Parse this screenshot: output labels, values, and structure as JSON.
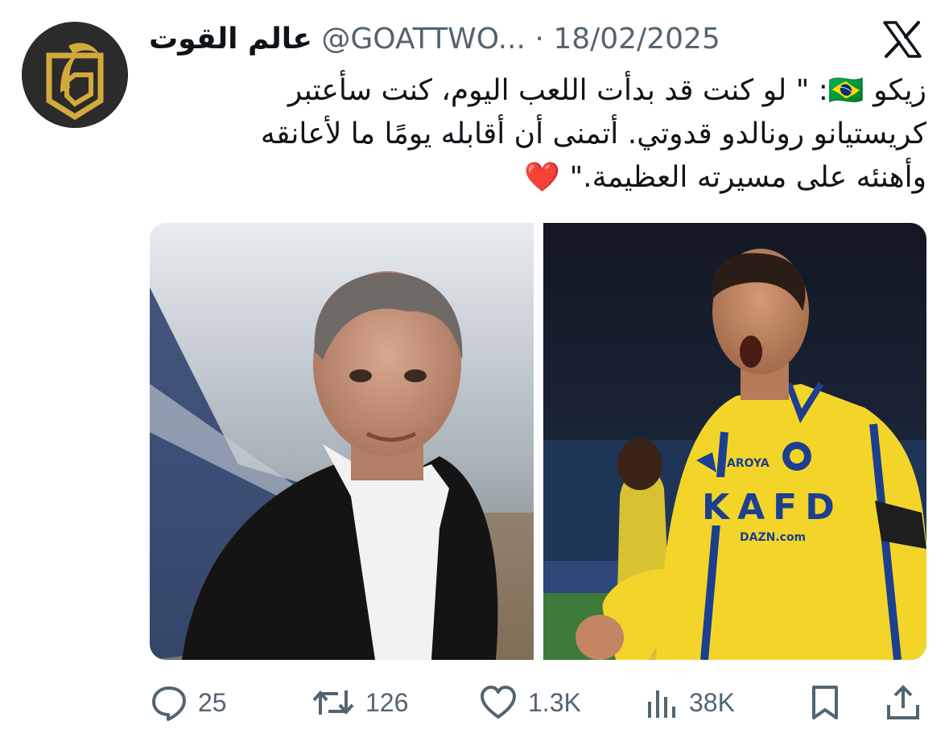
{
  "author": {
    "name": "عالم القوت",
    "handle": "@GOATTWO...",
    "separator": "·",
    "date": "18/02/2025"
  },
  "tweet": {
    "lines": [
      "زيكو 🇧🇷: \" لو كنت قد بدأت اللعب اليوم، كنت سأعتبر",
      "كريستيانو رونالدو قدوتي. أتمنى أن أقابله يومًا ما لأعانقه",
      "وأهنئه على مسيرته العظيمة.\" ❤️"
    ]
  },
  "media": {
    "left_photo": "man-in-suit-photo",
    "right_photo": "footballer-celebrating-photo",
    "jersey_text": "KAFD",
    "sponsor_text": "AROYA",
    "sleeve_text": "DAZN.com"
  },
  "actions": {
    "replies": "25",
    "reposts": "126",
    "likes": "1.3K",
    "views": "38K"
  },
  "icons": {
    "brand": "x-logo-icon",
    "reply": "reply-icon",
    "repost": "repost-icon",
    "like": "heart-icon",
    "views": "views-icon",
    "bookmark": "bookmark-icon",
    "share": "share-icon"
  },
  "colors": {
    "text": "#0f1419",
    "secondary": "#536471",
    "avatar_bg": "#2a2a2a",
    "avatar_logo": "#d4a93c",
    "jersey_yellow": "#f3d52a",
    "jersey_blue": "#1c3f8f"
  }
}
